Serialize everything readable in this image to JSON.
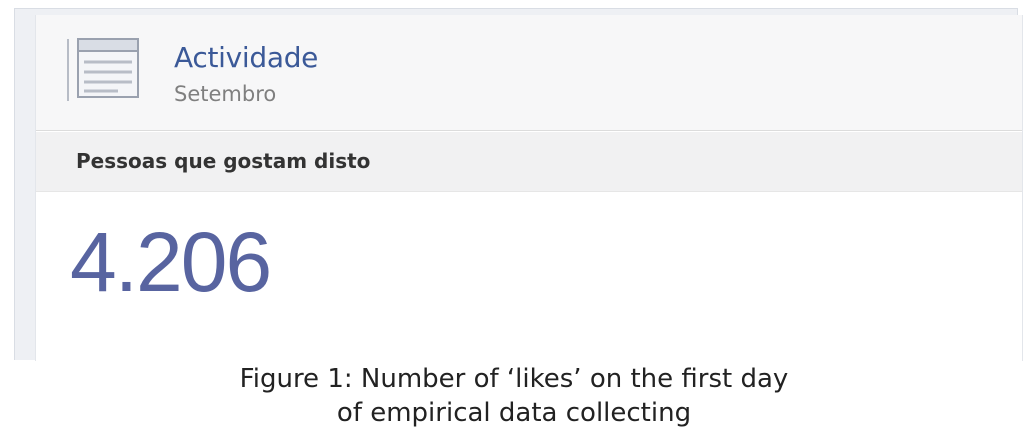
{
  "header": {
    "title": "Actividade",
    "subtitle": "Setembro",
    "icon": "activity-log-icon"
  },
  "section": {
    "label": "Pessoas que gostam disto"
  },
  "stat": {
    "value": "4.206"
  },
  "caption": {
    "line1": "Figure 1: Number of ‘likes’ on the first day",
    "line2": "of empirical data collecting"
  },
  "colors": {
    "accent": "#3b5998",
    "number": "#5864a0",
    "subtitle": "#7f7f7f"
  }
}
